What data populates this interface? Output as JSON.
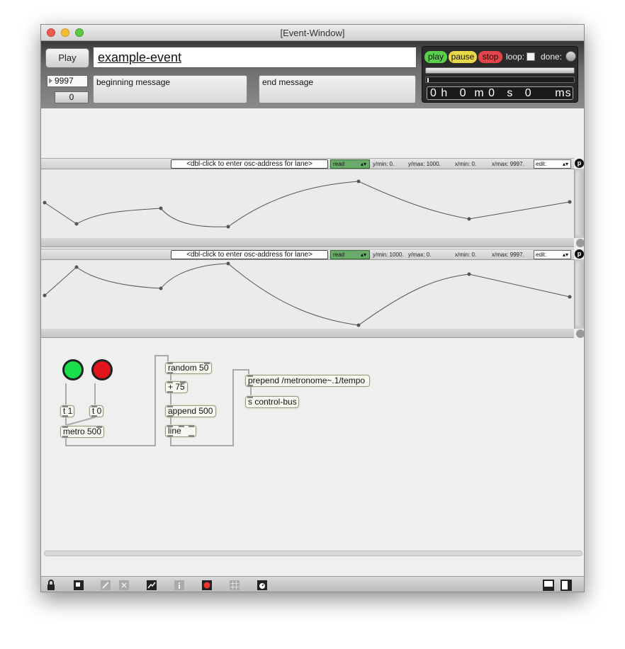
{
  "window": {
    "title": "[Event-Window]"
  },
  "header": {
    "play_label": "Play",
    "event_name": "example-event",
    "duration": "9997",
    "offset": "0",
    "begin_message": "beginning message",
    "end_message": "end message"
  },
  "transport": {
    "play": "play",
    "pause": "pause",
    "stop": "stop",
    "loop_label": "loop:",
    "done_label": "done:",
    "time_display": "0 h   0  m 0   s   0      ms"
  },
  "lanes": [
    {
      "address": "<dbl-click to enter osc-address for lane>",
      "mode": "read",
      "ymin": "y/min: 0.",
      "ymax": "y/max: 1000.",
      "xmin": "x/min: 0.",
      "xmax": "x/max: 9997.",
      "edit": "edit:",
      "badge": "p"
    },
    {
      "address": "<dbl-click to enter osc-address for lane>",
      "mode": "read",
      "ymin": "y/min: 1000.",
      "ymax": "y/max: 0.",
      "xmin": "x/min: 0.",
      "xmax": "x/max: 9997.",
      "edit": "edit:",
      "badge": "p"
    }
  ],
  "patch": {
    "go_color": "#19e04a",
    "stop_color": "#e0161c",
    "t1": "t 1",
    "t0": "t 0",
    "metro": "metro 500",
    "random": "random 50",
    "plus": "+ 75",
    "append": "append 500",
    "line": "line",
    "prepend": "prepend /metronome~.1/tempo",
    "send": "s control-bus"
  },
  "toolbar": {
    "icons": [
      "lock-icon",
      "presentation-icon",
      "edit-tools-icon",
      "delete-icon",
      "chart-icon",
      "info-icon",
      "record-icon",
      "grid-icon",
      "clock-settings-icon",
      "split-view-icon",
      "single-view-icon"
    ]
  }
}
